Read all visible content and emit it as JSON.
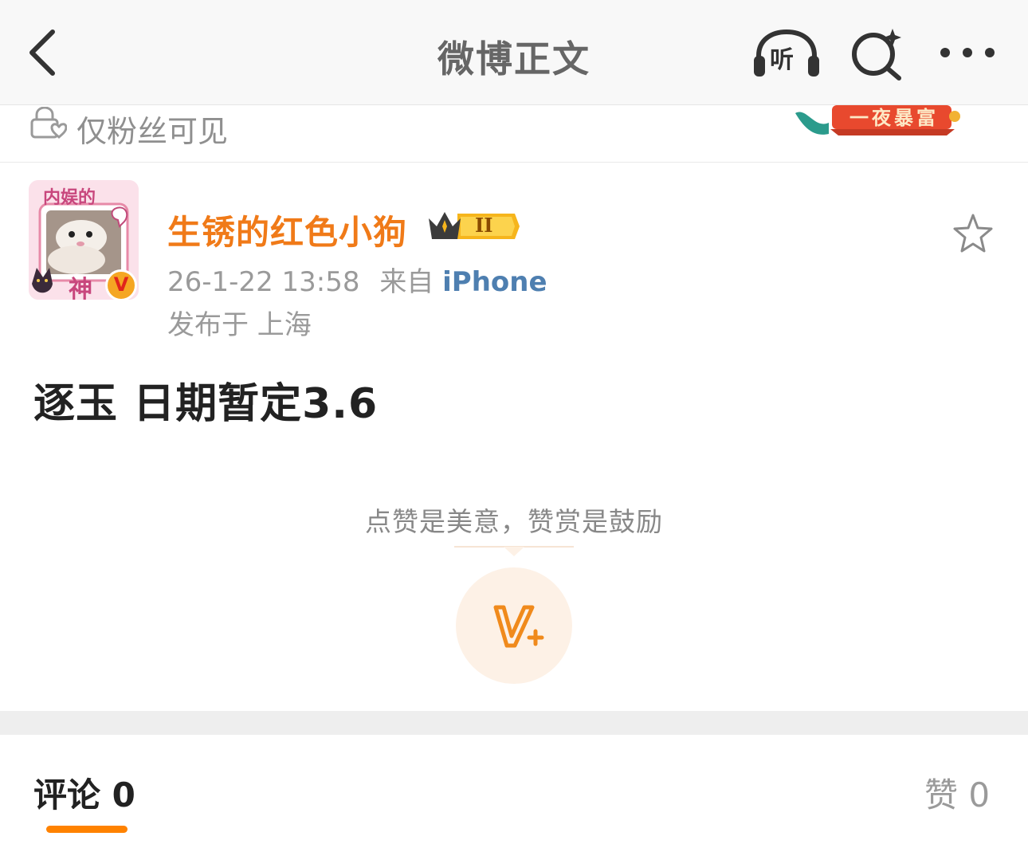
{
  "nav": {
    "title": "微博正文",
    "listen_label": "听"
  },
  "visibility": {
    "text": "仅粉丝可见",
    "badge_text": "一夜暴富"
  },
  "post": {
    "avatar_caption_top": "内娱的",
    "avatar_caption_bottom": "神",
    "vip_mark": "V",
    "author": "生锈的红色小狗",
    "member_level": "II",
    "time": "26-1-22 13:58",
    "source_prefix": "来自",
    "source": "iPhone",
    "location": "发布于 上海",
    "text": "逐玉 日期暂定3.6"
  },
  "reward": {
    "hint": "点赞是美意，赞赏是鼓励"
  },
  "tabs": {
    "comments": "评论 0",
    "likes": "赞 0"
  },
  "colors": {
    "author": "#f07a18",
    "source": "#4e7fb0",
    "accent": "#ff8200",
    "reward_bg": "#fdf1e6"
  }
}
